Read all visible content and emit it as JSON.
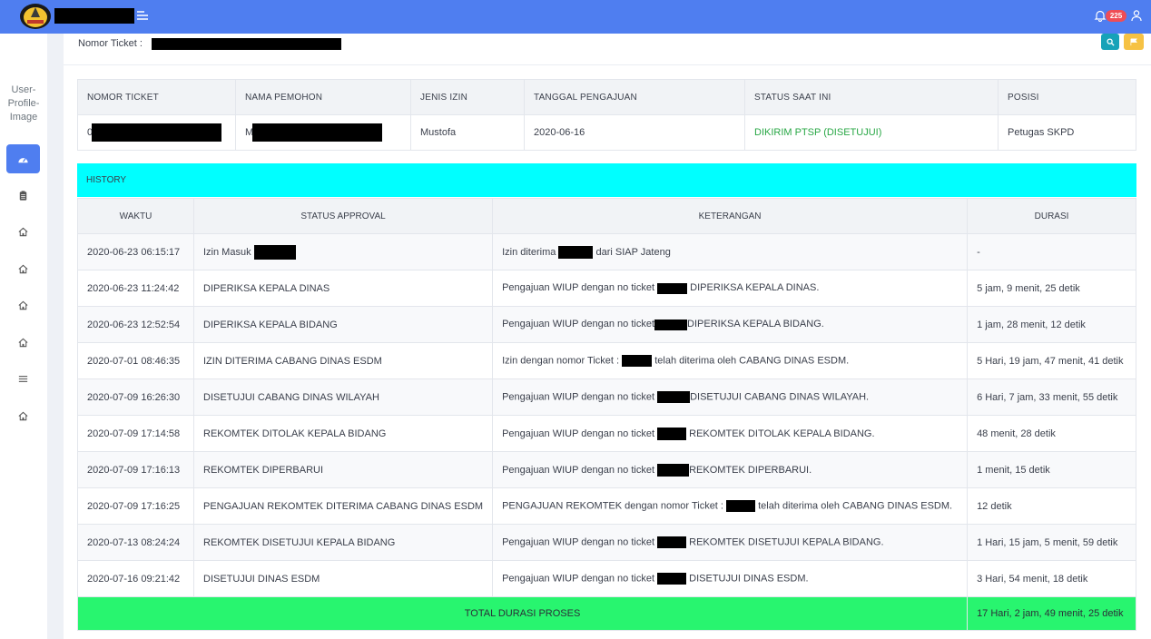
{
  "header": {
    "notification_count": "225"
  },
  "sidebar": {
    "profile_alt": "User-Profile-Image"
  },
  "page": {
    "ticket_label": "Nomor Ticket :"
  },
  "info_table": {
    "headers": [
      "NOMOR TICKET",
      "NAMA PEMOHON",
      "JENIS IZIN",
      "TANGGAL PENGAJUAN",
      "STATUS SAAT INI",
      "POSISI"
    ],
    "row": {
      "ticket_prefix": "0",
      "pemohon_prefix": "M",
      "jenis_izin": "Mustofa",
      "tanggal": "2020-06-16",
      "status": "DIKIRIM PTSP (DISETUJUI)",
      "posisi": "Petugas SKPD"
    },
    "status_color": "#28a745"
  },
  "history": {
    "title": "HISTORY",
    "headers": [
      "WAKTU",
      "STATUS APPROVAL",
      "KETERANGAN",
      "DURASI"
    ],
    "rows": [
      {
        "waktu": "2020-06-23 06:15:17",
        "status": "Izin Masuk",
        "ket_a": "Izin diterima",
        "ket_b": "dari SIAP Jateng",
        "durasi": "-"
      },
      {
        "waktu": "2020-06-23 11:24:42",
        "status": "DIPERIKSA KEPALA DINAS",
        "ket_a": "Pengajuan WIUP dengan no ticket",
        "ket_b": "DIPERIKSA KEPALA DINAS.",
        "durasi": "5 jam, 9 menit, 25 detik"
      },
      {
        "waktu": "2020-06-23 12:52:54",
        "status": "DIPERIKSA KEPALA BIDANG",
        "ket_a": "Pengajuan WIUP dengan no ticket",
        "ket_b": "DIPERIKSA KEPALA BIDANG.",
        "durasi": "1 jam, 28 menit, 12 detik"
      },
      {
        "waktu": "2020-07-01 08:46:35",
        "status": "IZIN DITERIMA CABANG DINAS ESDM",
        "ket_a": "Izin dengan nomor Ticket :",
        "ket_b": "telah diterima oleh CABANG DINAS ESDM.",
        "durasi": "5 Hari, 19 jam, 47 menit, 41 detik"
      },
      {
        "waktu": "2020-07-09 16:26:30",
        "status": "DISETUJUI CABANG DINAS WILAYAH",
        "ket_a": "Pengajuan WIUP dengan no ticket",
        "ket_b": "DISETUJUI CABANG DINAS WILAYAH.",
        "durasi": "6 Hari, 7 jam, 33 menit, 55 detik"
      },
      {
        "waktu": "2020-07-09 17:14:58",
        "status": "REKOMTEK DITOLAK KEPALA BIDANG",
        "ket_a": "Pengajuan WIUP dengan no ticket",
        "ket_b": "REKOMTEK DITOLAK KEPALA BIDANG.",
        "durasi": "48 menit, 28 detik"
      },
      {
        "waktu": "2020-07-09 17:16:13",
        "status": "REKOMTEK DIPERBARUI",
        "ket_a": "Pengajuan WIUP dengan no ticket",
        "ket_b": "REKOMTEK DIPERBARUI.",
        "durasi": "1 menit, 15 detik"
      },
      {
        "waktu": "2020-07-09 17:16:25",
        "status": "PENGAJUAN REKOMTEK DITERIMA CABANG DINAS ESDM",
        "ket_a": "PENGAJUAN REKOMTEK dengan nomor Ticket :",
        "ket_b": "telah diterima oleh CABANG DINAS ESDM.",
        "durasi": "12 detik"
      },
      {
        "waktu": "2020-07-13 08:24:24",
        "status": "REKOMTEK DISETUJUI KEPALA BIDANG",
        "ket_a": "Pengajuan WIUP dengan no ticket",
        "ket_b": "REKOMTEK DISETUJUI KEPALA BIDANG.",
        "durasi": "1 Hari, 15 jam, 5 menit, 59 detik"
      },
      {
        "waktu": "2020-07-16 09:21:42",
        "status": "DISETUJUI DINAS ESDM",
        "ket_a": "Pengajuan WIUP dengan no ticket",
        "ket_b": "DISETUJUI DINAS ESDM.",
        "durasi": "3 Hari, 54 menit, 18 detik"
      }
    ],
    "total_label": "TOTAL DURASI PROSES",
    "total_value": "17 Hari, 2 jam, 49 menit, 25 detik",
    "header_color": "#00ffff",
    "total_color": "#28f56f"
  }
}
